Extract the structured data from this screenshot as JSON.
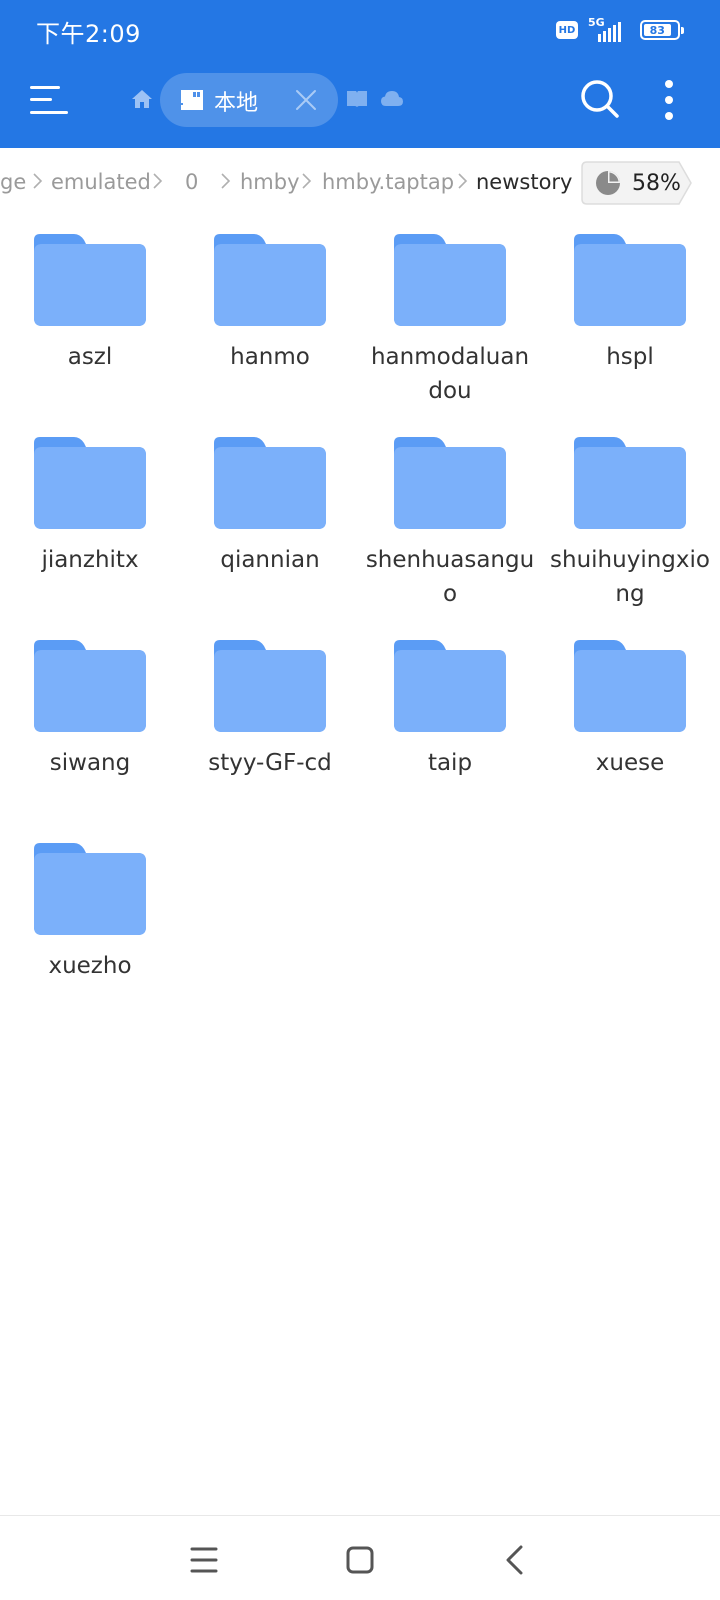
{
  "status_bar": {
    "time": "下午2:09",
    "hd": "HD",
    "network": "5G",
    "battery": "83"
  },
  "toolbar": {
    "current_tab_label": "本地",
    "icons": [
      "menu-icon",
      "home-icon",
      "sd-card-icon",
      "close-icon",
      "book-icon",
      "cloud-icon",
      "search-icon",
      "more-vertical-icon"
    ]
  },
  "breadcrumb": {
    "items": [
      "ge",
      "emulated",
      "0",
      "hmby",
      "hmby.taptap",
      "newstory"
    ]
  },
  "storage_usage": {
    "label": "58%",
    "percent": 58
  },
  "folders": [
    "aszl",
    "hanmo",
    "hanmodaluandou",
    "hspl",
    "jianzhitx",
    "qiannian",
    "shenhuasanguo",
    "shuihuyingxiong",
    "siwang",
    "styy-GF-cd",
    "taip",
    "xuese",
    "xuezho"
  ],
  "colors": {
    "appbar": "#2477e4",
    "folder_back": "#5b9cf5",
    "folder_front": "#7bb0fa"
  },
  "nav_bar": {
    "icons": [
      "recents-icon",
      "home-square-icon",
      "back-icon"
    ]
  }
}
